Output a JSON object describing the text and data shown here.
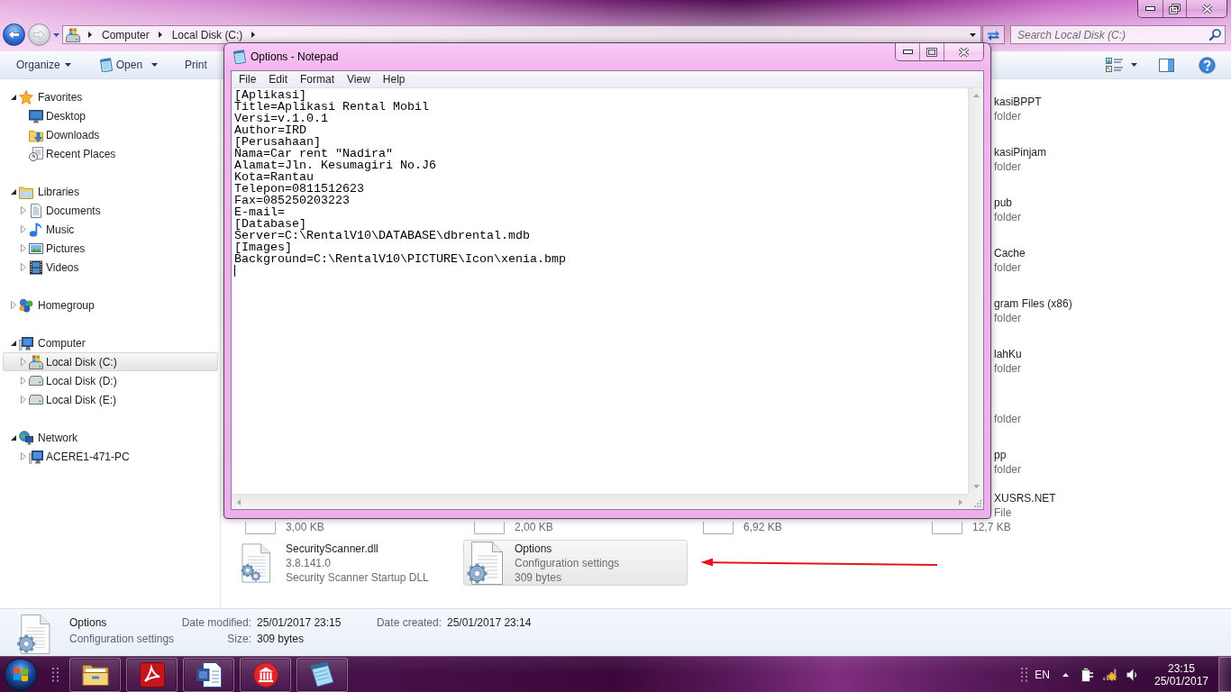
{
  "explorer": {
    "address_bar": {
      "crumbs": [
        "Computer",
        "Local Disk (C:)"
      ]
    },
    "search": {
      "placeholder": "Search Local Disk (C:)"
    },
    "toolbar": [
      {
        "label": "Organize",
        "kind": "menu"
      },
      {
        "label": "Open",
        "kind": "open"
      },
      {
        "label": "Print",
        "kind": "plain"
      }
    ],
    "sidebar": [
      {
        "label": "Favorites",
        "kind": "star",
        "expanded": true,
        "selected": false,
        "children": [
          {
            "label": "Desktop",
            "kind": "desktop",
            "selected": false
          },
          {
            "label": "Downloads",
            "kind": "downloads",
            "selected": false
          },
          {
            "label": "Recent Places",
            "kind": "recent",
            "selected": false
          }
        ]
      },
      {
        "label": "Libraries",
        "kind": "library",
        "expanded": true,
        "selected": false,
        "children": [
          {
            "label": "Documents",
            "kind": "documents",
            "expanded": false,
            "selected": false
          },
          {
            "label": "Music",
            "kind": "music",
            "expanded": false,
            "selected": false
          },
          {
            "label": "Pictures",
            "kind": "pictures",
            "expanded": false,
            "selected": false
          },
          {
            "label": "Videos",
            "kind": "videos",
            "expanded": false,
            "selected": false
          }
        ]
      },
      {
        "label": "Homegroup",
        "kind": "homegroup",
        "expanded": false,
        "selected": false
      },
      {
        "label": "Computer",
        "kind": "computer",
        "expanded": true,
        "selected": false,
        "children": [
          {
            "label": "Local Disk (C:)",
            "kind": "system-drive",
            "expanded": false,
            "selected": true
          },
          {
            "label": "Local Disk (D:)",
            "kind": "drive",
            "expanded": false,
            "selected": false
          },
          {
            "label": "Local Disk (E:)",
            "kind": "drive",
            "expanded": false,
            "selected": false
          }
        ]
      },
      {
        "label": "Network",
        "kind": "network",
        "expanded": true,
        "selected": false,
        "children": [
          {
            "label": "ACERE1-471-PC",
            "kind": "computer",
            "expanded": false,
            "selected": false
          }
        ]
      }
    ],
    "files": {
      "right_column": [
        {
          "name": "kasiBPPT",
          "type": "folder"
        },
        {
          "name": "kasiPinjam",
          "type": "folder"
        },
        {
          "name": "pub",
          "type": "folder"
        },
        {
          "name": "Cache",
          "type": "folder"
        },
        {
          "name": "gram Files (x86)",
          "type": "folder"
        },
        {
          "name": "lahKu",
          "type": "folder"
        },
        {
          "type": "folder"
        },
        {
          "name": "pp",
          "type": "folder"
        },
        {
          "name": "XUSRS.NET",
          "type": "File",
          "size": "12,7 KB"
        }
      ],
      "size_row": [
        "3,00 KB",
        "2,00 KB",
        "6,92 KB"
      ],
      "items": [
        {
          "name": "SecurityScanner.dll",
          "line_2": "3.8.141.0",
          "line_3": "Security Scanner Startup DLL",
          "kind": "dll",
          "selected": false
        },
        {
          "name": "Options",
          "line_2": "Configuration settings",
          "line_3": "309 bytes",
          "kind": "config",
          "selected": true
        }
      ]
    },
    "details": {
      "name": "Options",
      "type": "Configuration settings",
      "fields": [
        {
          "label": "Date modified:",
          "value": "25/01/2017 23:15"
        },
        {
          "label": "Date created:",
          "value": "25/01/2017 23:14"
        },
        {
          "label": "Size:",
          "value": "309 bytes"
        }
      ]
    }
  },
  "notepad": {
    "title": "Options - Notepad",
    "menu": [
      "File",
      "Edit",
      "Format",
      "View",
      "Help"
    ],
    "lines": [
      "[Aplikasi]",
      "Title=Aplikasi Rental Mobil",
      "Versi=v.1.0.1",
      "Author=IRD",
      "[Perusahaan]",
      "Nama=Car rent \"Nadira\"",
      "Alamat=Jln. Kesumagiri No.J6",
      "Kota=Rantau",
      "Telepon=0811512623",
      "Fax=085250203223",
      "E-mail=",
      "[Database]",
      "Server=C:\\RentalV10\\DATABASE\\dbrental.mdb",
      "[Images]",
      "Background=C:\\RentalV10\\PICTURE\\Icon\\xenia.bmp"
    ]
  },
  "taskbar": {
    "apps": [
      {
        "kind": "explorer"
      },
      {
        "kind": "pdf"
      },
      {
        "kind": "word"
      },
      {
        "kind": "museum"
      },
      {
        "kind": "notepad"
      }
    ],
    "language": "EN",
    "time": "23:15",
    "date": "25/01/2017"
  }
}
